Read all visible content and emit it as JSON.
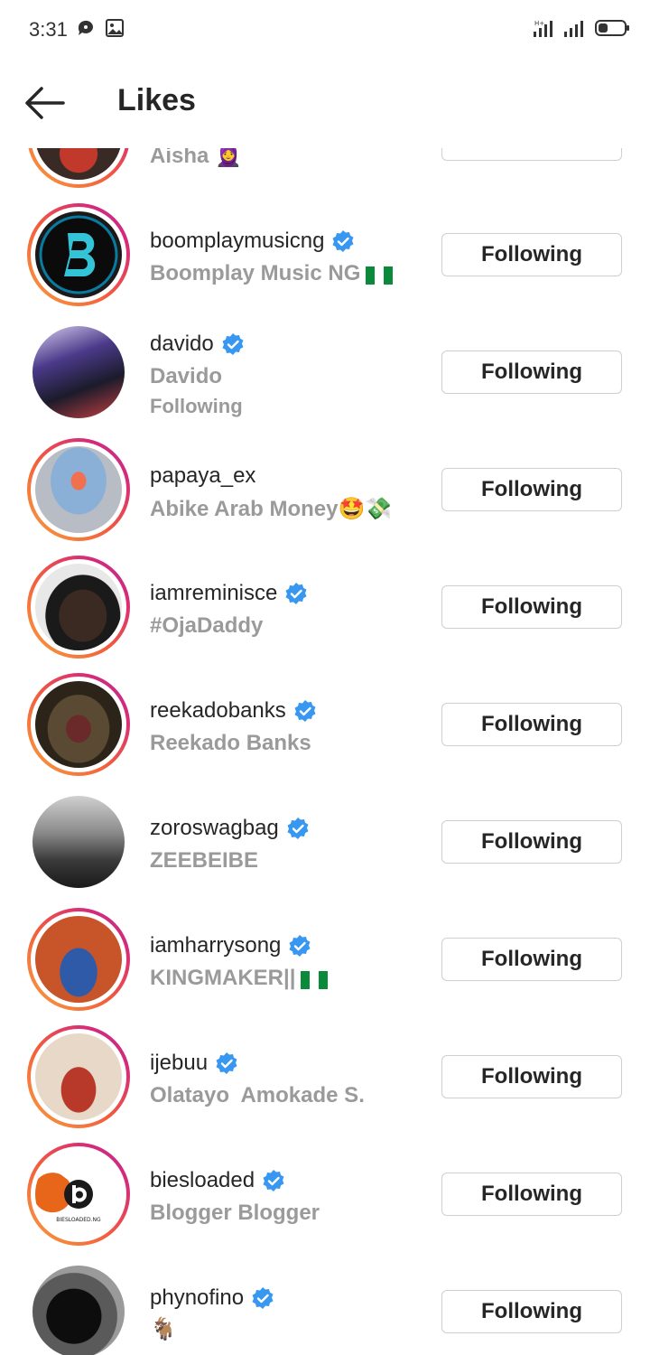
{
  "status_bar": {
    "time": "3:31"
  },
  "header": {
    "title": "Likes"
  },
  "colors": {
    "verified": "#3897f0",
    "ring_start": "#f9a13d",
    "ring_end": "#b4339b",
    "muted_text": "#9a9a9a"
  },
  "partial_top": {
    "fullname": "Aisha",
    "emoji": "🧕"
  },
  "users": [
    {
      "username": "boomplaymusicng",
      "verified": true,
      "fullname": "Boomplay Music NG",
      "flag": "NG",
      "button": "Following"
    },
    {
      "username": "davido",
      "verified": true,
      "fullname": "Davido",
      "subline": "Following",
      "button": "Following"
    },
    {
      "username": "papaya_ex",
      "verified": false,
      "fullname": "Abike Arab Money🤩💸",
      "button": "Following"
    },
    {
      "username": "iamreminisce",
      "verified": true,
      "fullname": "#OjaDaddy",
      "button": "Following"
    },
    {
      "username": "reekadobanks",
      "verified": true,
      "fullname": "Reekado Banks",
      "button": "Following"
    },
    {
      "username": "zoroswagbag",
      "verified": true,
      "fullname": "ZEEBEIBE",
      "button": "Following"
    },
    {
      "username": "iamharrysong",
      "verified": true,
      "fullname": "KINGMAKER||",
      "flag": "NG",
      "button": "Following"
    },
    {
      "username": "ijebuu",
      "verified": true,
      "fullname": "Olatayo  Amokade S.",
      "button": "Following"
    },
    {
      "username": "biesloaded",
      "verified": true,
      "fullname": "Blogger Blogger",
      "logo_text": "BIESLOADED.NG",
      "button": "Following"
    },
    {
      "username": "phynofino",
      "verified": true,
      "fullname": "🐐",
      "button": "Following"
    }
  ]
}
